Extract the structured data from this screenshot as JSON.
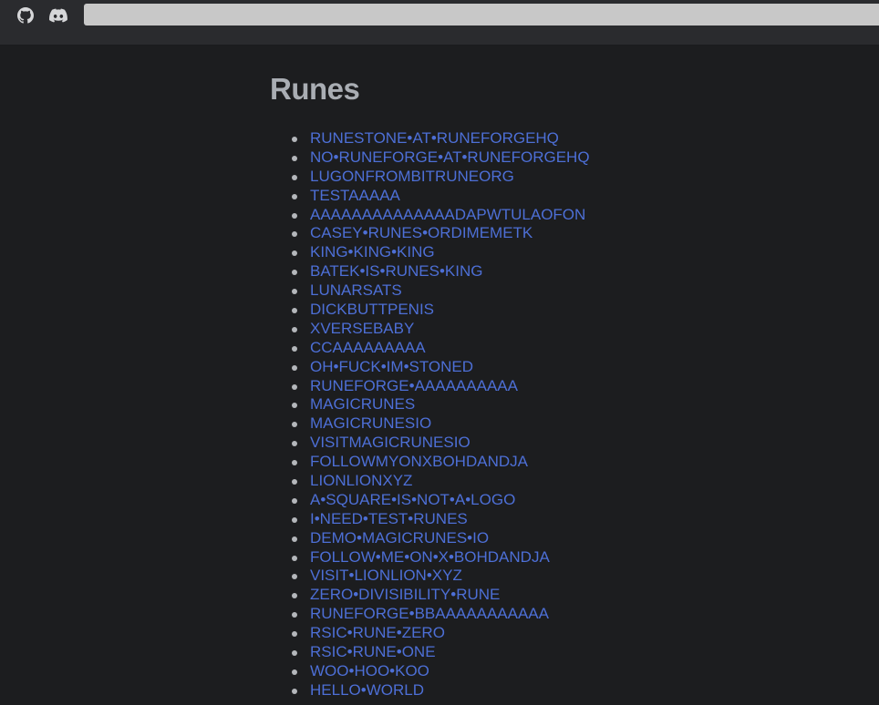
{
  "header": {
    "github_icon": "github-icon",
    "discord_icon": "discord-icon",
    "search_value": ""
  },
  "main": {
    "title": "Runes",
    "runes": [
      "RUNESTONE•AT•RUNEFORGEHQ",
      "NO•RUNEFORGE•AT•RUNEFORGEHQ",
      "LUGONFROMBITRUNEORG",
      "TESTAAAAA",
      "AAAAAAAAAAAAAADAPWTULAOFON",
      "CASEY•RUNES•ORDIMEMETK",
      "KING•KING•KING",
      "BATEK•IS•RUNES•KING",
      "LUNARSATS",
      "DICKBUTTPENIS",
      "XVERSEBABY",
      "CCAAAAAAAAA",
      "OH•FUCK•IM•STONED",
      "RUNEFORGE•AAAAAAAAAA",
      "MAGICRUNES",
      "MAGICRUNESIO",
      "VISITMAGICRUNESIO",
      "FOLLOWMYONXBOHDANDJA",
      "LIONLIONXYZ",
      "A•SQUARE•IS•NOT•A•LOGO",
      "I•NEED•TEST•RUNES",
      "DEMO•MAGICRUNES•IO",
      "FOLLOW•ME•ON•X•BOHDANDJA",
      "VISIT•LIONLION•XYZ",
      "ZERO•DIVISIBILITY•RUNE",
      "RUNEFORGE•BBAAAAAAAAAAA",
      "RSIC•RUNE•ZERO",
      "RSIC•RUNE•ONE",
      "WOO•HOO•KOO",
      "HELLO•WORLD"
    ]
  },
  "colors": {
    "background": "#1c1d1f",
    "header_background": "#2a2b2e",
    "title": "#a9adb3",
    "link": "#4d6fd6",
    "search_background": "#c8c8c8"
  }
}
